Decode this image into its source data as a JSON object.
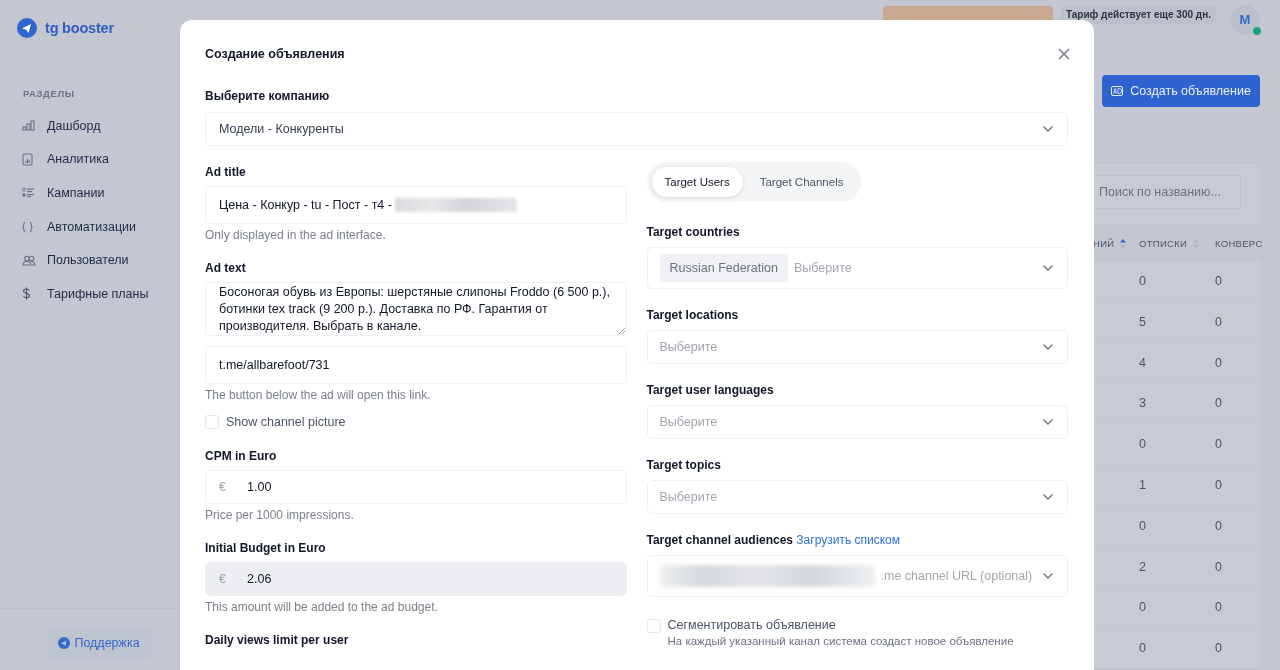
{
  "app": {
    "logo": "tg booster"
  },
  "sidebar": {
    "section_title": "РАЗДЕЛЫ",
    "items": [
      {
        "label": "Дашборд"
      },
      {
        "label": "Аналитика"
      },
      {
        "label": "Кампании"
      },
      {
        "label": "Автоматизации"
      },
      {
        "label": "Пользователи"
      },
      {
        "label": "Тарифные планы"
      }
    ],
    "support_button": "Поддержка"
  },
  "header": {
    "plan_notice": "Тариф действует еще 300 дн.",
    "avatar": "M",
    "online": true
  },
  "create_button": "Создать объявление",
  "table": {
    "search": {
      "placeholder": "Поиск по названию..."
    },
    "columns": [
      {
        "label": "НИЙ",
        "sorted": true
      },
      {
        "label": "ОТПИСКИ",
        "sorted": false
      },
      {
        "label": "КОНВЕРС"
      }
    ],
    "rows": [
      [
        "",
        "0",
        "0"
      ],
      [
        "",
        "5",
        "0"
      ],
      [
        "",
        "4",
        "0"
      ],
      [
        "",
        "3",
        "0"
      ],
      [
        "",
        "0",
        "0"
      ],
      [
        "",
        "1",
        "0"
      ],
      [
        "",
        "0",
        "0"
      ],
      [
        "",
        "2",
        "0"
      ],
      [
        "",
        "0",
        "0"
      ],
      [
        "",
        "0",
        "0"
      ]
    ]
  },
  "modal": {
    "title": "Создание объявления",
    "company": {
      "label": "Выберите компанию",
      "value": "Модели - Конкуренты"
    },
    "left_fields": [
      {
        "kind": "text",
        "label": "Ad title",
        "value": "Цена - Конкур -  tu - Пост - т4 -",
        "redacted": true,
        "help": "Only displayed in the ad interface."
      },
      {
        "kind": "textarea",
        "label": "Ad text",
        "value": "Босоногая обувь из Европы: шерстяные слипоны Froddo (6 500 р.), ботинки tex track (9 200 р.). Доставка по РФ. Гарантия от производителя. Выбрать в канале."
      },
      {
        "kind": "text",
        "value": "t.me/allbarefoot/731",
        "help": "The button below the ad will open this link."
      },
      {
        "kind": "checkbox",
        "label": "Show channel picture",
        "checked": false
      },
      {
        "kind": "money",
        "label": "CPM in Euro",
        "currency": "€",
        "value": "1.00",
        "disabled": false,
        "help": "Price per 1000 impressions."
      },
      {
        "kind": "money",
        "label": "Initial Budget in Euro",
        "currency": "€",
        "value": "2.06",
        "disabled": true,
        "help": "This amount will be added to the ad budget."
      },
      {
        "kind": "heading",
        "label": "Daily views limit per user"
      }
    ],
    "tabs": [
      {
        "label": "Target Users",
        "selected": true
      },
      {
        "label": "Target Channels",
        "selected": false
      }
    ],
    "right_fields": [
      {
        "kind": "select",
        "label": "Target countries",
        "chips": [
          "Russian Federation"
        ],
        "placeholder": "Выберите"
      },
      {
        "kind": "select",
        "label": "Target locations",
        "placeholder": "Выберите"
      },
      {
        "kind": "select",
        "label": "Target user languages",
        "placeholder": "Выберите"
      },
      {
        "kind": "select",
        "label": "Target topics",
        "placeholder": "Выберите"
      },
      {
        "kind": "select",
        "label": "Target channel audiences",
        "link": "Загрузить списком",
        "placeholder": ".me channel URL (optional)",
        "redacted": true
      },
      {
        "kind": "checkbox",
        "label": "Сегментировать объявление",
        "description": "На каждый указанный канал система создаст новое объявление",
        "checked": false
      }
    ]
  }
}
